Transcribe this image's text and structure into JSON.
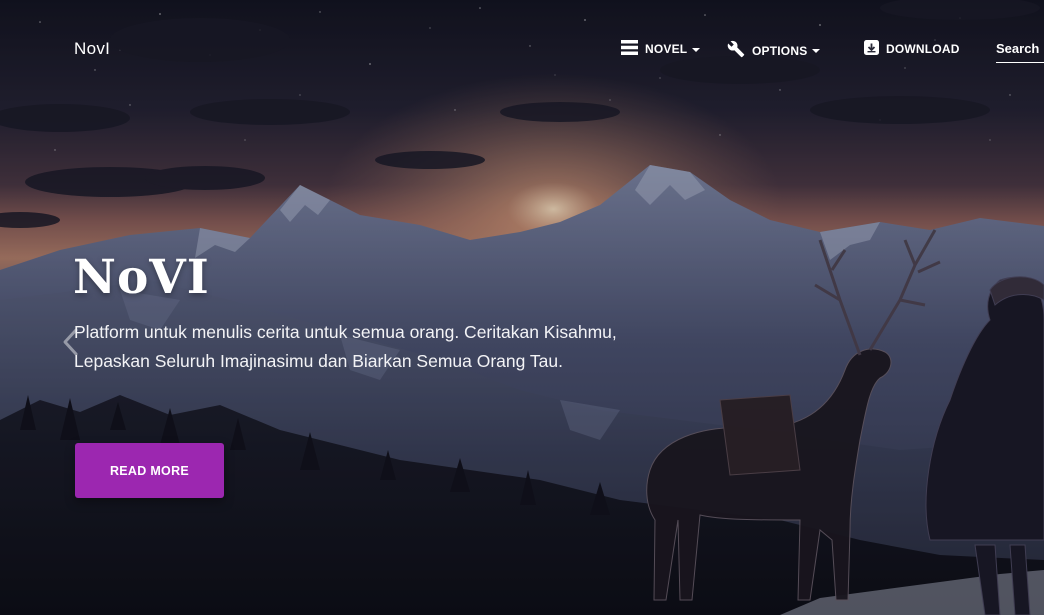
{
  "navbar": {
    "brand": "NovI",
    "items": [
      {
        "label": "NOVEL",
        "icon": "menu-icon",
        "has_dropdown": true
      },
      {
        "label": "OPTIONS",
        "icon": "wrench-icon",
        "has_dropdown": true
      },
      {
        "label": "DOWNLOAD",
        "icon": "download-box-icon",
        "has_dropdown": false
      }
    ],
    "search": {
      "placeholder": "Search",
      "value": ""
    }
  },
  "hero": {
    "title": "NoVI",
    "description": "Platform untuk menulis cerita untuk semua orang. Ceritakan Kisahmu, Lepaskan Seluruh Imajinasimu dan Biarkan Semua Orang Tau.",
    "button_label": "READ MORE",
    "prev_icon": "chevron-left-icon"
  },
  "colors": {
    "accent": "#9c27b0",
    "sky_top": "#141522",
    "sky_horizon": "#b4806a",
    "mountain": "#39405a",
    "text": "#ffffff"
  }
}
